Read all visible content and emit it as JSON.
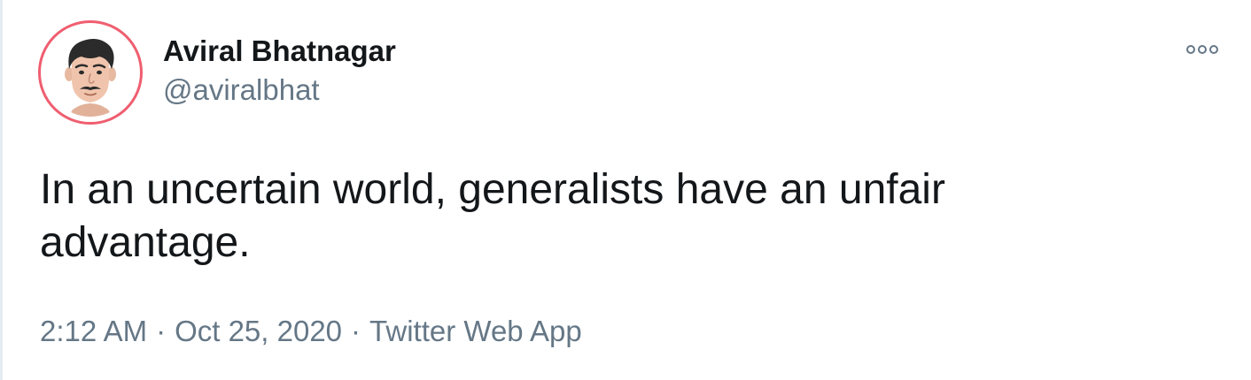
{
  "tweet": {
    "author": {
      "display_name": "Aviral Bhatnagar",
      "handle": "@aviralbhat",
      "avatar_icon": "avatar-illustration-icon"
    },
    "text": "In an uncertain world, generalists have an unfair advantage.",
    "meta": {
      "time": "2:12 AM",
      "separator": "·",
      "date": "Oct 25, 2020",
      "source": "Twitter Web App"
    },
    "more_icon": "more-options-icon"
  },
  "colors": {
    "text_primary": "#14171a",
    "text_secondary": "#657786",
    "avatar_ring": "#ef5e70"
  }
}
